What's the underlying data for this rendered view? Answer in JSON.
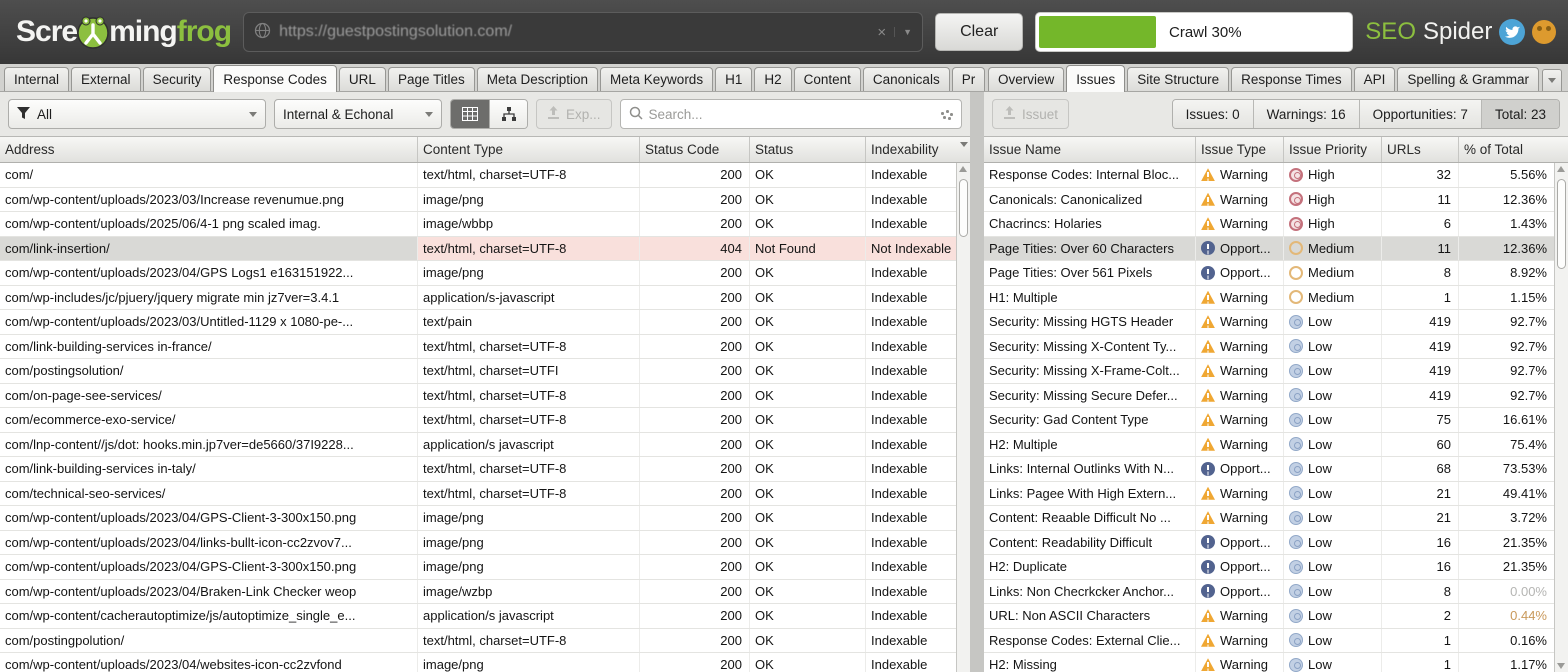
{
  "topbar": {
    "logo": {
      "part1": "Scre",
      "part2": "ming",
      "part3": "frog"
    },
    "url_input": {
      "value": "https://guestpostingsolution.com/"
    },
    "clear_button": "Clear",
    "crawl": {
      "label": "Crawl 30%",
      "fill_percent": 37
    },
    "brand": {
      "green": "SEO",
      "white": "Spider"
    }
  },
  "left_tabs": [
    {
      "label": "Internal",
      "active": false
    },
    {
      "label": "External",
      "active": false
    },
    {
      "label": "Security",
      "active": false
    },
    {
      "label": "Response Codes",
      "active": true
    },
    {
      "label": "URL",
      "active": false
    },
    {
      "label": "Page Titles",
      "active": false
    },
    {
      "label": "Meta Description",
      "active": false
    },
    {
      "label": "Meta Keywords",
      "active": false
    },
    {
      "label": "H1",
      "active": false
    },
    {
      "label": "H2",
      "active": false
    },
    {
      "label": "Content",
      "active": false
    },
    {
      "label": "Canonicals",
      "active": false
    },
    {
      "label": "Pr",
      "active": false
    }
  ],
  "right_tabs": [
    {
      "label": "Overview",
      "active": false
    },
    {
      "label": "Issues",
      "active": true
    },
    {
      "label": "Site Structure",
      "active": false
    },
    {
      "label": "Response Times",
      "active": false
    },
    {
      "label": "API",
      "active": false
    },
    {
      "label": "Spelling & Grammar",
      "active": false
    }
  ],
  "left_toolbar": {
    "filter_dropdown": "All",
    "scope_dropdown": "Internal & Echonal",
    "export_button": "Exp...",
    "search_placeholder": "Search..."
  },
  "right_toolbar": {
    "export_button": "Issuet",
    "counters": [
      {
        "label": "Issues: 0",
        "selected": false
      },
      {
        "label": "Warnings: 16",
        "selected": false
      },
      {
        "label": "Opportunities: 7",
        "selected": false
      },
      {
        "label": "Total: 23",
        "selected": true
      }
    ]
  },
  "left_table": {
    "columns": [
      "Address",
      "Content Type",
      "Status Code",
      "Status",
      "Indexability"
    ],
    "rows": [
      {
        "address": "com/",
        "content_type": "text/html, charset=UTF-8",
        "status_code": "200",
        "status": "OK",
        "indexability": "Indexable",
        "state": "normal"
      },
      {
        "address": "com/wp-content/uploads/2023/03/Increase revenumue.png",
        "content_type": "image/png",
        "status_code": "200",
        "status": "OK",
        "indexability": "Indexable",
        "state": "normal"
      },
      {
        "address": "com/wp-content/uploads/2025/06/4-1 png scaled imag.",
        "content_type": "image/wbbp",
        "status_code": "200",
        "status": "OK",
        "indexability": "Indexable",
        "state": "normal"
      },
      {
        "address": "com/link-insertion/",
        "content_type": "text/html, charset=UTF-8",
        "status_code": "404",
        "status": "Not Found",
        "indexability": "Not Indexable",
        "state": "error-selected"
      },
      {
        "address": "com/wp-content/uploads/2023/04/GPS Logs1 e163151922...",
        "content_type": "image/png",
        "status_code": "200",
        "status": "OK",
        "indexability": "Indexable",
        "state": "normal"
      },
      {
        "address": "com/wp-includes/jc/pjuery/jquery migrate min jz7ver=3.4.1",
        "content_type": "application/s-javascript",
        "status_code": "200",
        "status": "OK",
        "indexability": "Indexable",
        "state": "normal"
      },
      {
        "address": "com/wp-content/uploads/2023/03/Untitled-1129 x 1080-pe-...",
        "content_type": "text/pain",
        "status_code": "200",
        "status": "OK",
        "indexability": "Indexable",
        "state": "normal"
      },
      {
        "address": "com/link-building-services in-france/",
        "content_type": "text/html, charset=UTF-8",
        "status_code": "200",
        "status": "OK",
        "indexability": "Indexable",
        "state": "normal"
      },
      {
        "address": "com/postingsolution/",
        "content_type": "text/html, charset=UTFI",
        "status_code": "200",
        "status": "OK",
        "indexability": "Indexable",
        "state": "normal"
      },
      {
        "address": "com/on-page-see-services/",
        "content_type": "text/html, charset=UTF-8",
        "status_code": "200",
        "status": "OK",
        "indexability": "Indexable",
        "state": "normal"
      },
      {
        "address": "com/ecommerce-exo-service/",
        "content_type": "text/html, charset=UTF-8",
        "status_code": "200",
        "status": "OK",
        "indexability": "Indexable",
        "state": "normal"
      },
      {
        "address": "com/lnp-content//js/dot: hooks.min.jp7ver=de5660/37I9228...",
        "content_type": "application/s javascript",
        "status_code": "200",
        "status": "OK",
        "indexability": "Indexable",
        "state": "normal"
      },
      {
        "address": "com/link-building-services in-taly/",
        "content_type": "text/html, charset=UTF-8",
        "status_code": "200",
        "status": "OK",
        "indexability": "Indexable",
        "state": "normal"
      },
      {
        "address": "com/technical-seo-services/",
        "content_type": "text/html, charset=UTF-8",
        "status_code": "200",
        "status": "OK",
        "indexability": "Indexable",
        "state": "normal"
      },
      {
        "address": "com/wp-content/uploads/2023/04/GPS-Client-3-300x150.png",
        "content_type": "image/png",
        "status_code": "200",
        "status": "OK",
        "indexability": "Indexable",
        "state": "normal"
      },
      {
        "address": "com/wp-content/uploads/2023/04/links-bullt-icon-cc2zvov7...",
        "content_type": "image/png",
        "status_code": "200",
        "status": "OK",
        "indexability": "Indexable",
        "state": "normal"
      },
      {
        "address": "com/wp-content/uploads/2023/04/GPS-Client-3-300x150.png",
        "content_type": "image/png",
        "status_code": "200",
        "status": "OK",
        "indexability": "Indexable",
        "state": "normal"
      },
      {
        "address": "com/wp-content/uploads/2023/04/Braken-Link Checker weop",
        "content_type": "image/wzbp",
        "status_code": "200",
        "status": "OK",
        "indexability": "Indexable",
        "state": "normal"
      },
      {
        "address": "com/wp-content/cacherautoptimize/js/autoptimize_single_e...",
        "content_type": "application/s javascript",
        "status_code": "200",
        "status": "OK",
        "indexability": "Indexable",
        "state": "normal"
      },
      {
        "address": "com/postingpolution/",
        "content_type": "text/html, charset=UTF-8",
        "status_code": "200",
        "status": "OK",
        "indexability": "Indexable",
        "state": "normal"
      },
      {
        "address": "com/wp-content/uploads/2023/04/websites-icon-cc2zvfond",
        "content_type": "image/png",
        "status_code": "200",
        "status": "OK",
        "indexability": "Indexable",
        "state": "normal"
      }
    ]
  },
  "right_table": {
    "columns": [
      "Issue Name",
      "Issue Type",
      "Issue Priority",
      "URLs",
      "% of Total"
    ],
    "rows": [
      {
        "name": "Response Codes: Internal Bloc...",
        "type": "Warning",
        "priority": "High",
        "urls": "32",
        "pct": "5.56%",
        "selected": false
      },
      {
        "name": "Canonicals: Canonicalized",
        "type": "Warning",
        "priority": "High",
        "urls": "11",
        "pct": "12.36%",
        "selected": false
      },
      {
        "name": "Chacrincs: Holaries",
        "type": "Warning",
        "priority": "High",
        "urls": "6",
        "pct": "1.43%",
        "selected": false
      },
      {
        "name": "Page Tities: Over 60 Characters",
        "type": "Opport...",
        "priority": "Medium",
        "urls": "11",
        "pct": "12.36%",
        "selected": true
      },
      {
        "name": "Page Tities: Over 561 Pixels",
        "type": "Opport...",
        "priority": "Medium",
        "urls": "8",
        "pct": "8.92%",
        "selected": false
      },
      {
        "name": "H1: Multiple",
        "type": "Warning",
        "priority": "Medium",
        "urls": "1",
        "pct": "1.15%",
        "selected": false
      },
      {
        "name": "Security: Missing HGTS Header",
        "type": "Warning",
        "priority": "Low",
        "urls": "419",
        "pct": "92.7%",
        "selected": false
      },
      {
        "name": "Security: Missing X-Content Ty...",
        "type": "Warning",
        "priority": "Low",
        "urls": "419",
        "pct": "92.7%",
        "selected": false
      },
      {
        "name": "Security: Missing X-Frame-Colt...",
        "type": "Warning",
        "priority": "Low",
        "urls": "419",
        "pct": "92.7%",
        "selected": false
      },
      {
        "name": "Security: Missing Secure Defer...",
        "type": "Warning",
        "priority": "Low",
        "urls": "419",
        "pct": "92.7%",
        "selected": false
      },
      {
        "name": "Security: Gad Content Type",
        "type": "Warning",
        "priority": "Low",
        "urls": "75",
        "pct": "16.61%",
        "selected": false
      },
      {
        "name": "H2: Multiple",
        "type": "Warning",
        "priority": "Low",
        "urls": "60",
        "pct": "75.4%",
        "selected": false
      },
      {
        "name": "Links: Internal Outlinks With N...",
        "type": "Opport...",
        "priority": "Low",
        "urls": "68",
        "pct": "73.53%",
        "selected": false
      },
      {
        "name": "Links: Pagee With High Extern...",
        "type": "Warning",
        "priority": "Low",
        "urls": "21",
        "pct": "49.41%",
        "selected": false
      },
      {
        "name": "Content: Reaable Difficult No ...",
        "type": "Warning",
        "priority": "Low",
        "urls": "21",
        "pct": "3.72%",
        "selected": false
      },
      {
        "name": "Content: Readability Difficult",
        "type": "Opport...",
        "priority": "Low",
        "urls": "16",
        "pct": "21.35%",
        "selected": false
      },
      {
        "name": "H2: Duplicate",
        "type": "Opport...",
        "priority": "Low",
        "urls": "16",
        "pct": "21.35%",
        "selected": false
      },
      {
        "name": "Links: Non Checrkcker Anchor...",
        "type": "Opport...",
        "priority": "Low",
        "urls": "8",
        "pct": "0.00%",
        "pct_style": "faded",
        "selected": false
      },
      {
        "name": "URL: Non ASCII Characters",
        "type": "Warning",
        "priority": "Low",
        "urls": "2",
        "pct": "0.44%",
        "pct_style": "warn",
        "selected": false
      },
      {
        "name": "Response Codes: External Clie...",
        "type": "Warning",
        "priority": "Low",
        "urls": "1",
        "pct": "0.16%",
        "selected": false
      },
      {
        "name": "H2: Missing",
        "type": "Warning",
        "priority": "Low",
        "urls": "1",
        "pct": "1.17%",
        "selected": false
      }
    ]
  },
  "colors": {
    "accent_green": "#8cbf3f",
    "progress_green": "#74b72a",
    "warning_icon": "#efa733",
    "opportunity_icon": "#52638f",
    "high_icon": "#c4717c",
    "medium_icon": "#e3b878",
    "low_icon": "#c2d0e4",
    "error_row": "#f9e0dc",
    "selected_row": "#d9d9d6"
  }
}
